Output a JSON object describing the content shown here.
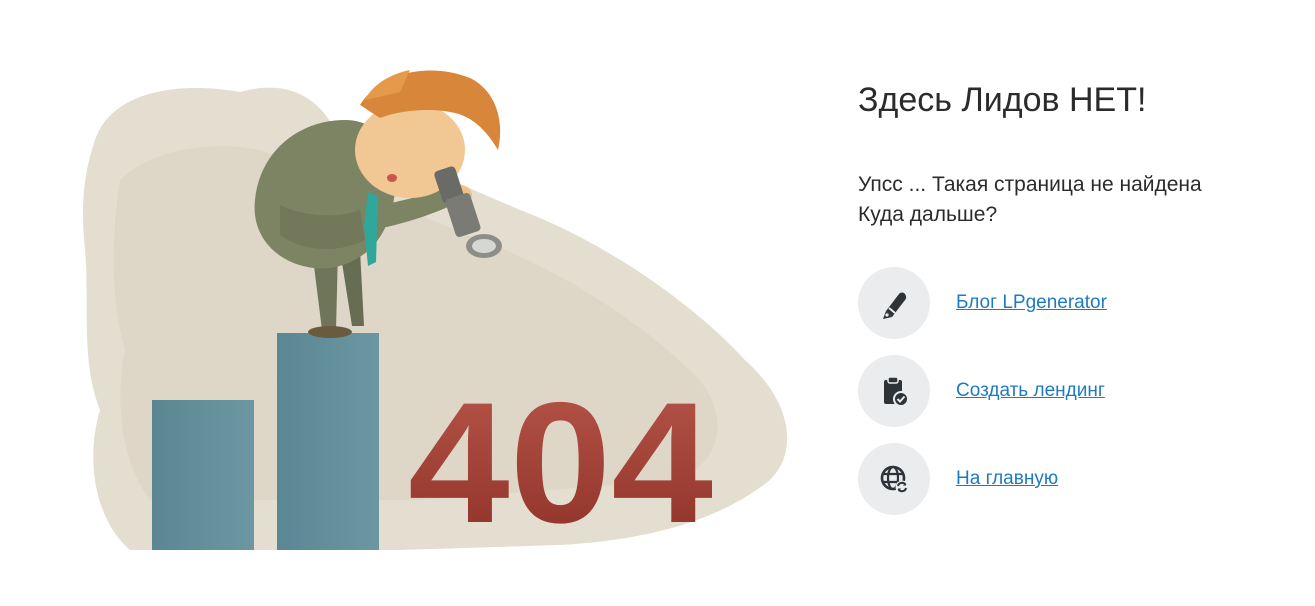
{
  "heading": "Здесь Лидов НЕТ!",
  "message": {
    "line1": "Упсс ... Такая страница не найдена",
    "line2": "Куда дальше?"
  },
  "illustration": {
    "error_code": "404"
  },
  "links": [
    {
      "label": "Блог LPgenerator",
      "icon": "pen-icon"
    },
    {
      "label": "Создать лендинг",
      "icon": "clipboard-check-icon"
    },
    {
      "label": "На главную",
      "icon": "globe-refresh-icon"
    }
  ],
  "colors": {
    "link": "#1f7bc1",
    "icon_bg": "#eaecee",
    "icon_fg": "#2e3338",
    "bars": "#5e8a96",
    "code": "#a9463b",
    "backdrop": "#e4ded1"
  }
}
